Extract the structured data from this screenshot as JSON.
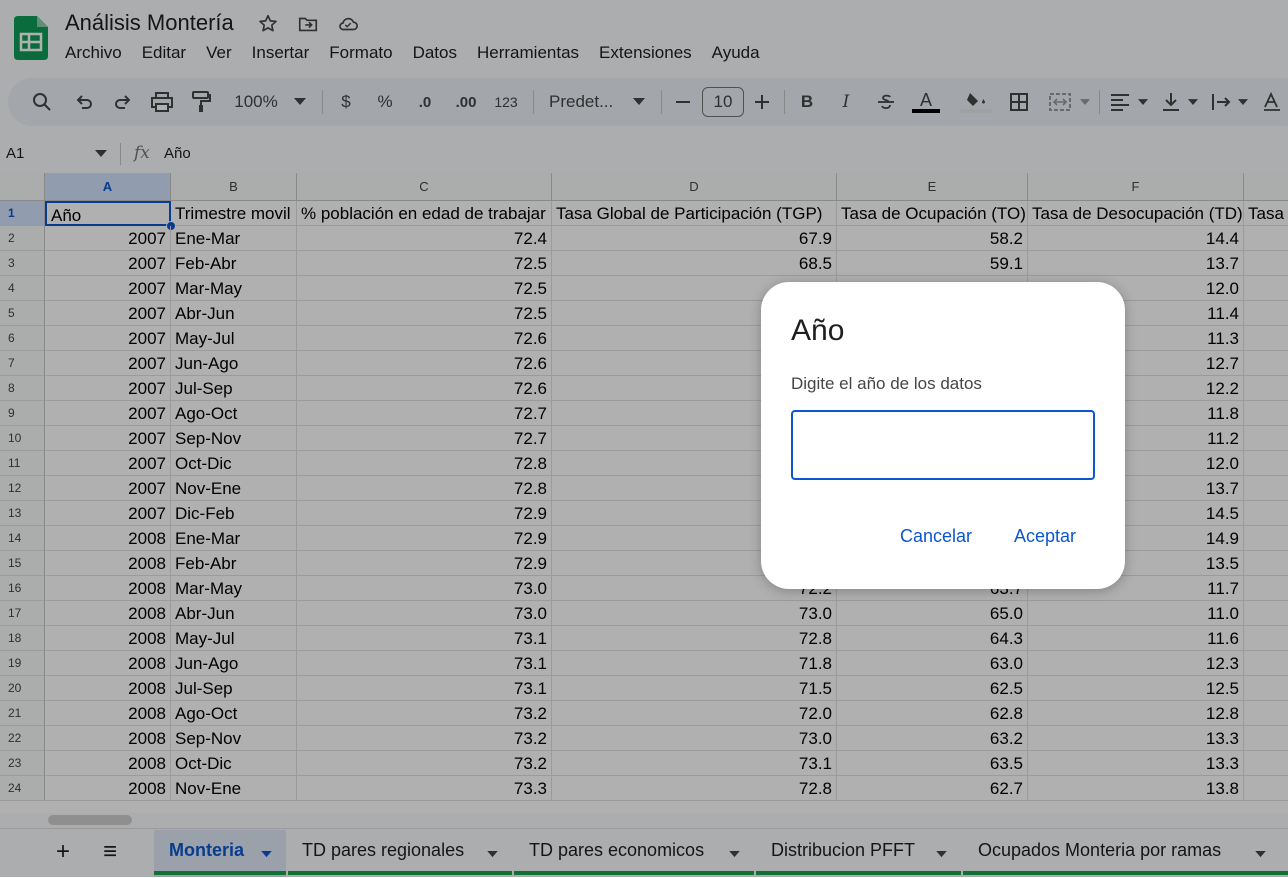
{
  "doc_title": "Análisis Montería",
  "menu": [
    "Archivo",
    "Editar",
    "Ver",
    "Insertar",
    "Formato",
    "Datos",
    "Herramientas",
    "Extensiones",
    "Ayuda"
  ],
  "toolbar": {
    "zoom": "100%",
    "currency": "$",
    "percent": "%",
    "dec_less": ".0",
    "dec_more": ".00",
    "num_format": "123",
    "font": "Predet...",
    "font_size": "10",
    "bold": "B",
    "italic": "I",
    "text_color": "A",
    "icons": [
      "search-icon",
      "undo-icon",
      "redo-icon",
      "print-icon",
      "paint-format-icon",
      "chevron-down-icon",
      "minus-icon",
      "plus-icon",
      "strikethrough-icon",
      "fill-color-icon",
      "borders-icon",
      "merge-cells-icon",
      "align-left-icon",
      "valign-bottom-icon",
      "text-wrap-icon",
      "text-rotation-icon"
    ]
  },
  "formula_bar": {
    "cell_ref": "A1",
    "fx": "fx",
    "value": "Año"
  },
  "grid": {
    "col_headers": [
      "A",
      "B",
      "C",
      "D",
      "E",
      "F"
    ],
    "header_row": [
      "Año",
      "Trimestre movil",
      "% población en edad de trabajar",
      "Tasa Global de Participación (TGP)",
      "Tasa de Ocupación (TO)",
      "Tasa de Desocupación (TD)",
      "Tasa"
    ],
    "rows": [
      [
        "2",
        "2007",
        "Ene-Mar",
        "72.4",
        "67.9",
        "58.2",
        "14.4"
      ],
      [
        "3",
        "2007",
        "Feb-Abr",
        "72.5",
        "68.5",
        "59.1",
        "13.7"
      ],
      [
        "4",
        "2007",
        "Mar-May",
        "72.5",
        "",
        "",
        "12.0"
      ],
      [
        "5",
        "2007",
        "Abr-Jun",
        "72.5",
        "",
        "",
        "11.4"
      ],
      [
        "6",
        "2007",
        "May-Jul",
        "72.6",
        "",
        "",
        "11.3"
      ],
      [
        "7",
        "2007",
        "Jun-Ago",
        "72.6",
        "",
        "",
        "12.7"
      ],
      [
        "8",
        "2007",
        "Jul-Sep",
        "72.6",
        "",
        "",
        "12.2"
      ],
      [
        "9",
        "2007",
        "Ago-Oct",
        "72.7",
        "",
        "",
        "11.8"
      ],
      [
        "10",
        "2007",
        "Sep-Nov",
        "72.7",
        "",
        "",
        "11.2"
      ],
      [
        "11",
        "2007",
        "Oct-Dic",
        "72.8",
        "",
        "",
        "12.0"
      ],
      [
        "12",
        "2007",
        "Nov-Ene",
        "72.8",
        "",
        "",
        "13.7"
      ],
      [
        "13",
        "2007",
        "Dic-Feb",
        "72.9",
        "",
        "",
        "14.5"
      ],
      [
        "14",
        "2008",
        "Ene-Mar",
        "72.9",
        "",
        "",
        "14.9"
      ],
      [
        "15",
        "2008",
        "Feb-Abr",
        "72.9",
        "",
        "",
        "13.5"
      ],
      [
        "16",
        "2008",
        "Mar-May",
        "73.0",
        "72.2",
        "63.7",
        "11.7"
      ],
      [
        "17",
        "2008",
        "Abr-Jun",
        "73.0",
        "73.0",
        "65.0",
        "11.0"
      ],
      [
        "18",
        "2008",
        "May-Jul",
        "73.1",
        "72.8",
        "64.3",
        "11.6"
      ],
      [
        "19",
        "2008",
        "Jun-Ago",
        "73.1",
        "71.8",
        "63.0",
        "12.3"
      ],
      [
        "20",
        "2008",
        "Jul-Sep",
        "73.1",
        "71.5",
        "62.5",
        "12.5"
      ],
      [
        "21",
        "2008",
        "Ago-Oct",
        "73.2",
        "72.0",
        "62.8",
        "12.8"
      ],
      [
        "22",
        "2008",
        "Sep-Nov",
        "73.2",
        "73.0",
        "63.2",
        "13.3"
      ],
      [
        "23",
        "2008",
        "Oct-Dic",
        "73.2",
        "73.1",
        "63.5",
        "13.3"
      ],
      [
        "24",
        "2008",
        "Nov-Ene",
        "73.3",
        "72.8",
        "62.7",
        "13.8"
      ]
    ]
  },
  "sheets": {
    "add": "+",
    "list": "≡",
    "tabs": [
      "Monteria",
      "TD pares regionales",
      "TD pares economicos",
      "Distribucion PFFT",
      "Ocupados Monteria por ramas"
    ]
  },
  "dialog": {
    "title": "Año",
    "prompt": "Digite el año de los datos",
    "input_value": "",
    "cancel": "Cancelar",
    "accept": "Aceptar"
  },
  "colors": {
    "accent": "#0b57d0",
    "sheet_green": "#1aa34a",
    "logo_green": "#0f9d58"
  }
}
